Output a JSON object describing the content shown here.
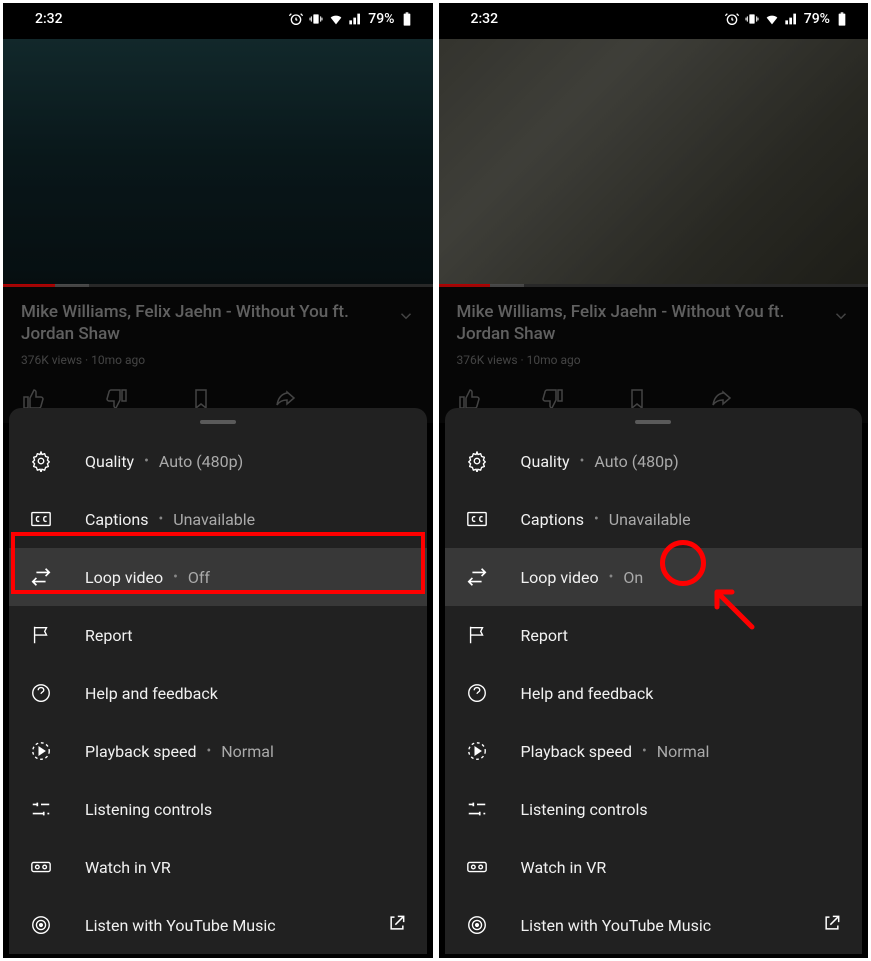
{
  "status": {
    "time": "2:32",
    "battery": "79%"
  },
  "video": {
    "title": "Mike Williams, Felix Jaehn - Without You ft. Jordan Shaw",
    "meta": "376K views · 10mo ago"
  },
  "menu": {
    "quality": {
      "label": "Quality",
      "value": "Auto (480p)"
    },
    "captions": {
      "label": "Captions",
      "value": "Unavailable"
    },
    "loop": {
      "label": "Loop video"
    },
    "report": {
      "label": "Report"
    },
    "help": {
      "label": "Help and feedback"
    },
    "speed": {
      "label": "Playback speed",
      "value": "Normal"
    },
    "listening": {
      "label": "Listening controls"
    },
    "vr": {
      "label": "Watch in VR"
    },
    "ytmusic": {
      "label": "Listen with YouTube Music"
    }
  },
  "left": {
    "loopValue": "Off"
  },
  "right": {
    "loopValue": "On"
  }
}
